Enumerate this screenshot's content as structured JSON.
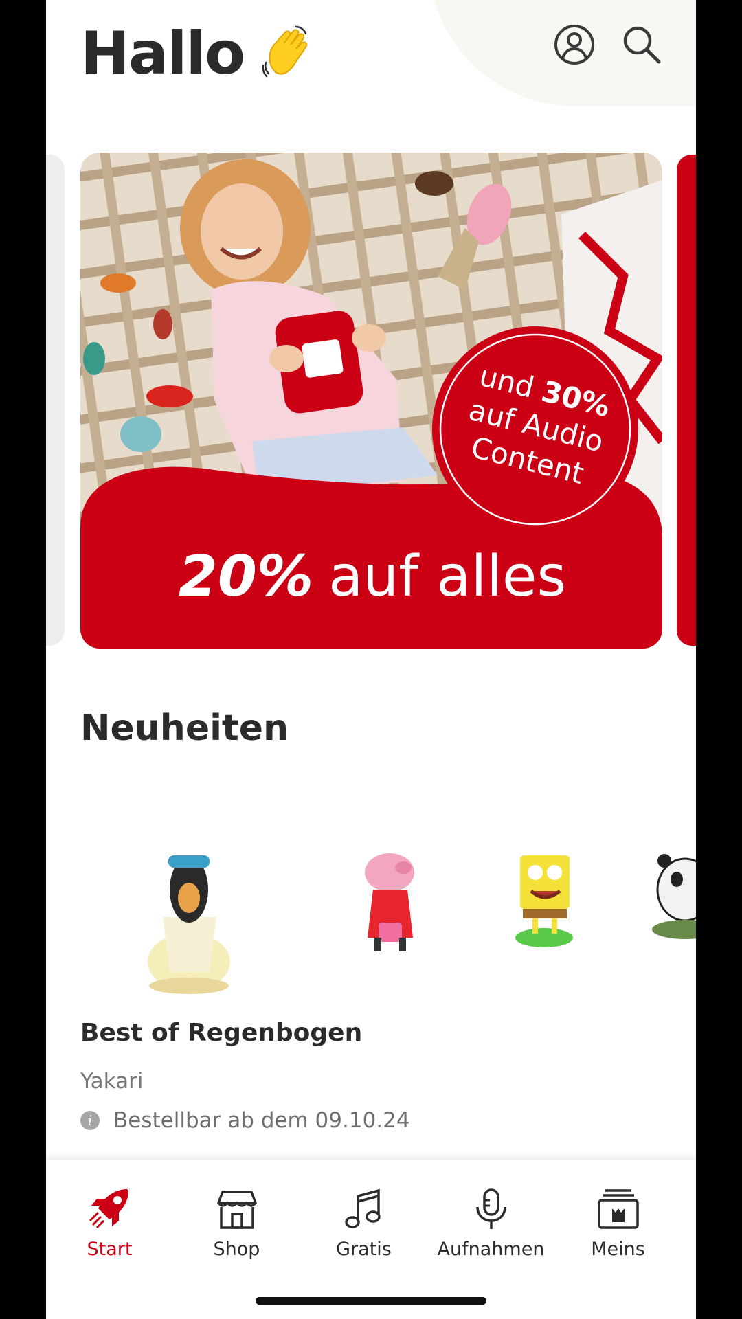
{
  "header": {
    "greeting": "Hallo"
  },
  "banner": {
    "headline_bold": "20%",
    "headline_rest": "auf alles",
    "badge_line1_pre": "und ",
    "badge_line1_bold": "30%",
    "badge_line2": "auf Audio",
    "badge_line3": "Content"
  },
  "section": {
    "title": "Neuheiten"
  },
  "product": {
    "title": "Best of Regenbogen",
    "subtitle": "Yakari",
    "availability": "Bestellbar ab dem 09.10.24"
  },
  "tabs": [
    {
      "label": "Start",
      "icon": "rocket-icon",
      "active": true
    },
    {
      "label": "Shop",
      "icon": "store-icon"
    },
    {
      "label": "Gratis",
      "icon": "music-note-icon"
    },
    {
      "label": "Aufnahmen",
      "icon": "microphone-icon"
    },
    {
      "label": "Meins",
      "icon": "box-icon"
    }
  ],
  "colors": {
    "accent": "#cc0015",
    "text": "#2b2b2b"
  }
}
